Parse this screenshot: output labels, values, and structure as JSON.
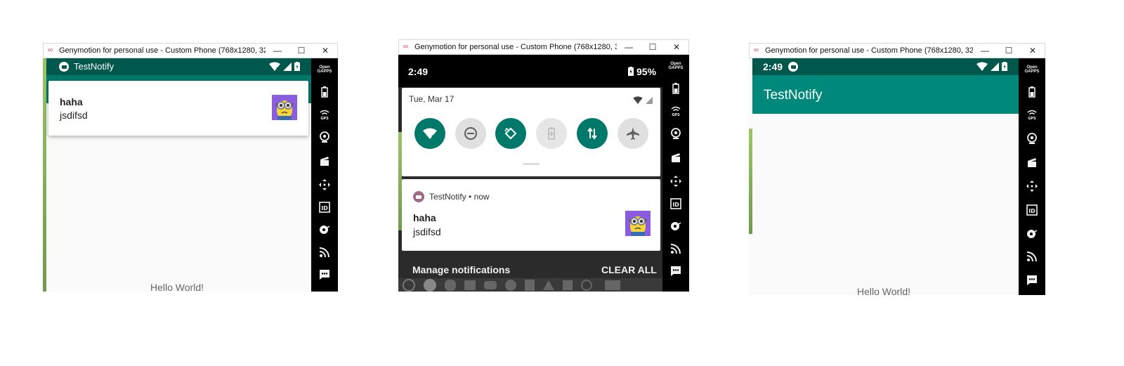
{
  "window_title": "Genymotion for personal use - Custom Phone (768x1280, 320dpi) ...",
  "window_controls": {
    "minimize": "—",
    "maximize": "☐",
    "close": "✕"
  },
  "sidebar": {
    "gapps_line1": "Open",
    "gapps_line2": "GAPPS"
  },
  "panel1": {
    "app_name": "TestNotify",
    "notification": {
      "title": "haha",
      "text": "jsdifsd"
    },
    "hello": "Hello World!"
  },
  "panel2": {
    "time": "2:49",
    "battery": "95%",
    "date": "Tue, Mar 17",
    "notification": {
      "app": "TestNotify",
      "sep": "•",
      "when": "now",
      "title": "haha",
      "text": "jsdifsd"
    },
    "manage": "Manage notifications",
    "clear_all": "CLEAR ALL"
  },
  "panel3": {
    "time": "2:49",
    "app_title": "TestNotify",
    "hello": "Hello World!"
  },
  "colors": {
    "teal": "#00796b",
    "teal_dark": "#00574b",
    "teal_toolbar": "#00897b",
    "gray_shade": "#e0e0e0"
  }
}
